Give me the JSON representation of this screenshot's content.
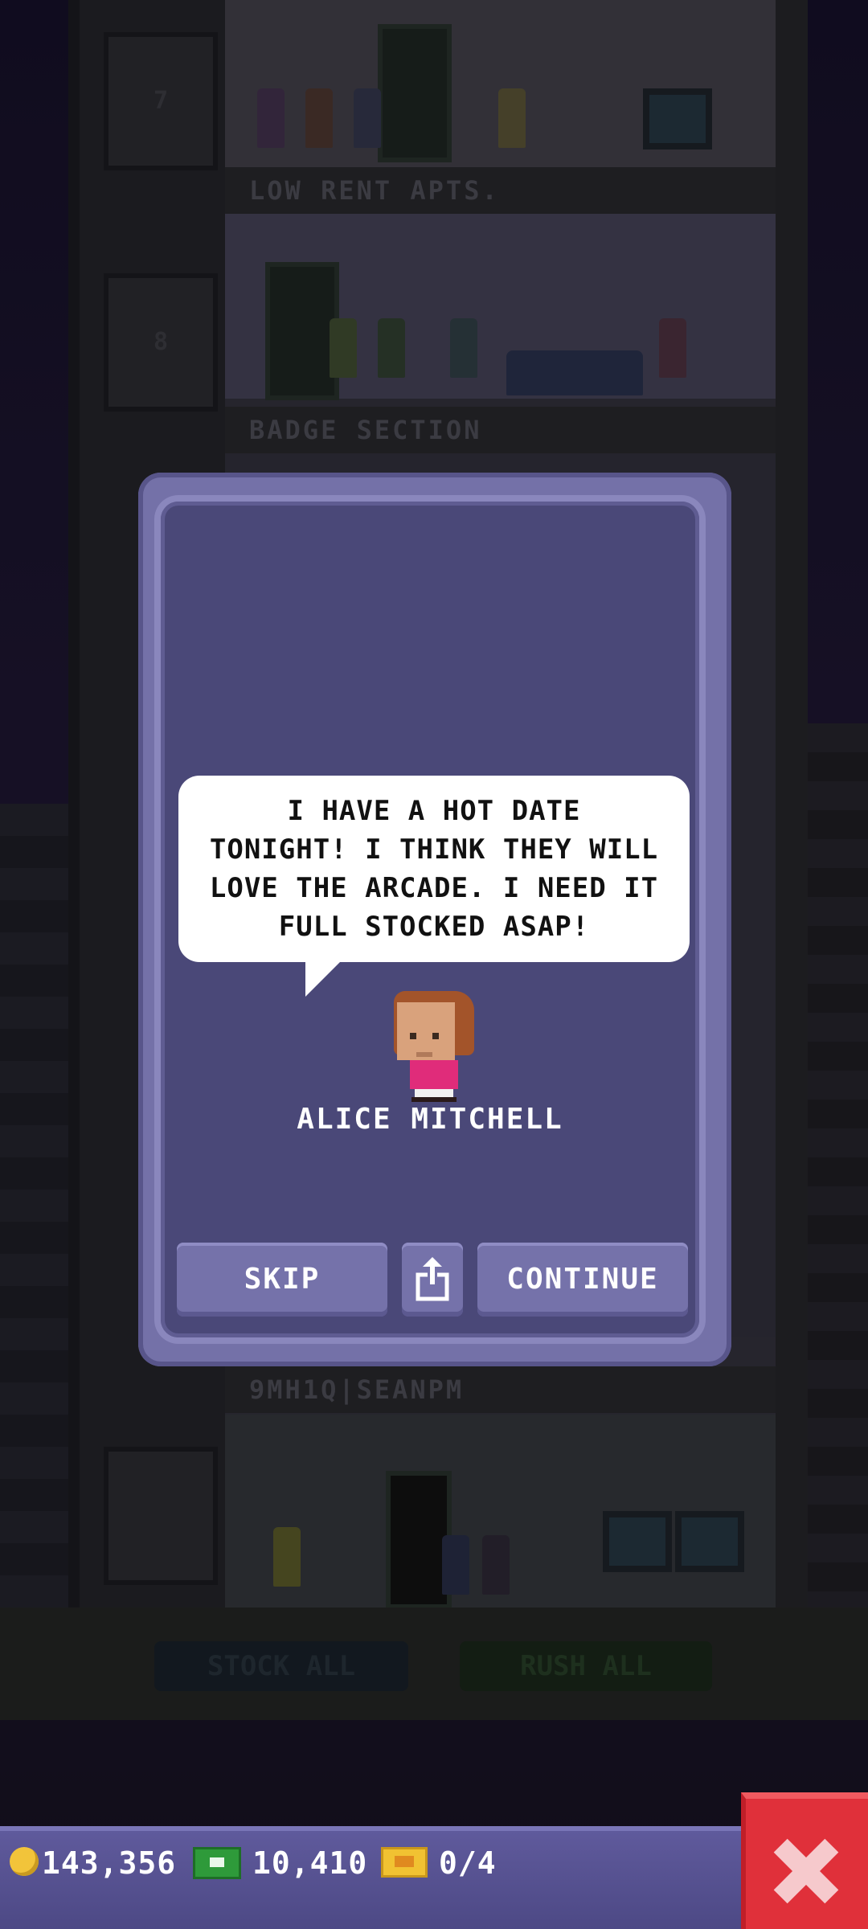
{
  "tower": {
    "floor_7_number": "7",
    "floor_8_number": "8",
    "floor_labels": [
      "LOW RENT APTS.",
      "BADGE SECTION",
      "9MH1Q|SEANPM"
    ],
    "bg_buttons": {
      "stock_all": "STOCK ALL",
      "rush_all": "RUSH ALL"
    }
  },
  "dialog": {
    "message": "I HAVE A HOT DATE\nTONIGHT! I THINK THEY WILL\nLOVE THE ARCADE. I NEED IT\nFULL STOCKED ASAP!",
    "character_name": "ALICE MITCHELL",
    "skip_label": "SKIP",
    "continue_label": "CONTINUE",
    "share_icon": "share-icon",
    "colors": {
      "panel": "#4a4878",
      "frame": "#7471a8",
      "shirt": "#e02c7a"
    }
  },
  "hud": {
    "coins": "143,356",
    "bux": "10,410",
    "tickets": "0/4",
    "close_icon": "close-icon"
  }
}
